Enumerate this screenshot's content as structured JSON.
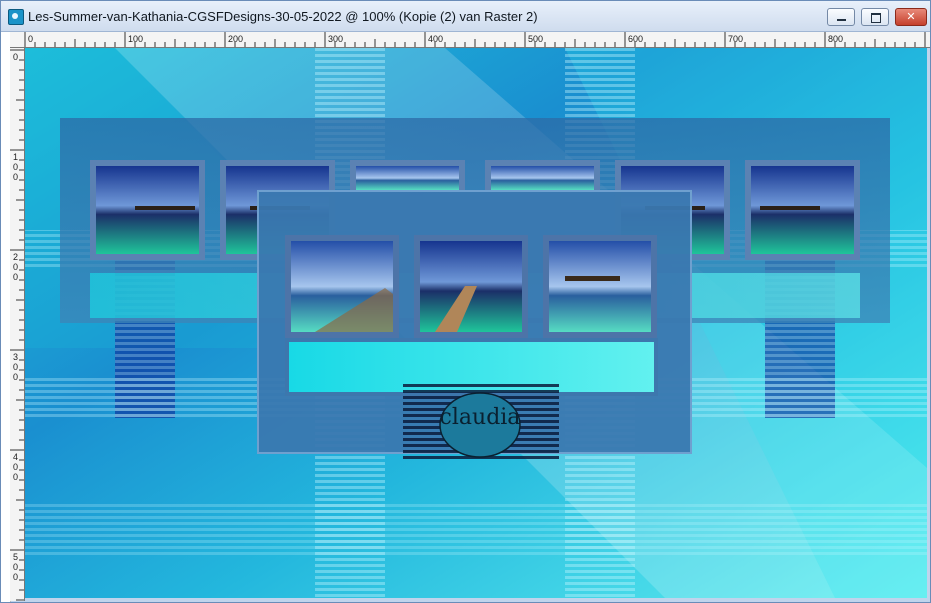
{
  "window": {
    "title": "Les-Summer-van-Kathania-CGSFDesigns-30-05-2022 @ 100% (Kopie (2) van Raster 2)",
    "buttons": {
      "minimize": "minimize",
      "maximize": "maximize",
      "close": "✕"
    }
  },
  "rulers": {
    "horizontal_labels": [
      "0",
      "100",
      "200",
      "300",
      "400",
      "500",
      "600",
      "700",
      "800"
    ],
    "vertical_labels": [
      "0",
      "1\n0\n0",
      "2\n0\n0",
      "3\n0\n0",
      "4\n0\n0",
      "5\n0\n0"
    ]
  },
  "canvas": {
    "signature": "claudia",
    "colors": {
      "cyan": "#2fe0ee",
      "deep_blue": "#0a2fa0",
      "steel_blue": "#3a6fa8",
      "frame": "#4b77a8"
    }
  }
}
